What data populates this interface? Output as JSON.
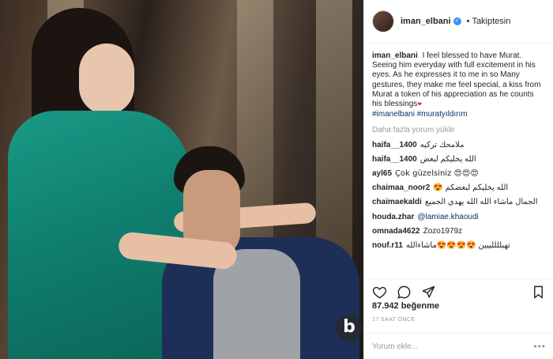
{
  "post": {
    "username": "iman_elbani",
    "follow_status": "Takiptesin",
    "dot": "•",
    "caption": "I feel blessed to have Murat. Seeing him everyday with full excitement in his eyes. As he expresses it to me in so Many gestures, they make me feel special, a kiss from Murat a token of his appreciation as he counts his blessings",
    "heart": "❤",
    "hashtags": [
      "#imanelbani",
      "#muratyıldırım"
    ],
    "load_more": "Daha fazla yorum yükle",
    "comments": [
      {
        "user": "haifa__1400",
        "text": "ملامحك تركيه"
      },
      {
        "user": "haifa__1400",
        "text": "الله يخليكم لبعض"
      },
      {
        "user": "ayl65",
        "text": "Çok güzelsiniz 😍😍😍"
      },
      {
        "user": "chaimaa_noor2",
        "text": "الله يخليكم لبعضكم 😍"
      },
      {
        "user": "chaimaekaldi",
        "text": "الجمال ماشاء الله الله يهدي الجميع"
      },
      {
        "user": "houda.zhar",
        "text": "@lamiae.khaoudi"
      },
      {
        "user": "omnada4622",
        "text": "Zozo1979z"
      },
      {
        "user": "nouf.r11",
        "text": "تهبللللييين 😍😍😍😍ماشاءالله"
      }
    ],
    "likes": "87.942 beğenme",
    "time": "17 SAAT ÖNCE",
    "comment_placeholder": "Yorum ekle...",
    "more_options": "•••"
  },
  "watermark": "b",
  "colors": {
    "link": "#003569",
    "muted": "#999999",
    "verified": "#3897f0",
    "dress": "#0f7d6d"
  },
  "icons": [
    "heart-outline-icon",
    "comment-icon",
    "share-icon",
    "bookmark-icon",
    "verified-icon"
  ]
}
